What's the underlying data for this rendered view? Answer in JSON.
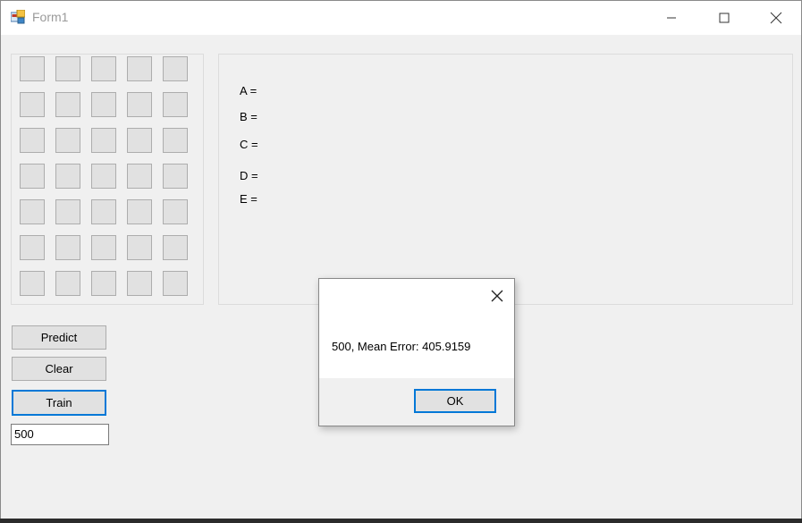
{
  "window": {
    "title": "Form1",
    "icon": "winforms-app-icon"
  },
  "caption_buttons": {
    "minimize": "minimize-icon",
    "maximize": "maximize-icon",
    "close": "close-icon"
  },
  "grid": {
    "rows": 7,
    "cols": 5
  },
  "labels": {
    "a": "A =",
    "b": "B =",
    "c": "C =",
    "d": "D =",
    "e": "E ="
  },
  "buttons": {
    "predict": "Predict",
    "clear": "Clear",
    "train": "Train"
  },
  "iterations_input": {
    "value": "500"
  },
  "message_box": {
    "message": "500, Mean Error: 405.9159",
    "ok_label": "OK"
  },
  "colors": {
    "focus_accent": "#0078d7",
    "form_background": "#f0f0f0",
    "button_face": "#e1e1e1"
  }
}
